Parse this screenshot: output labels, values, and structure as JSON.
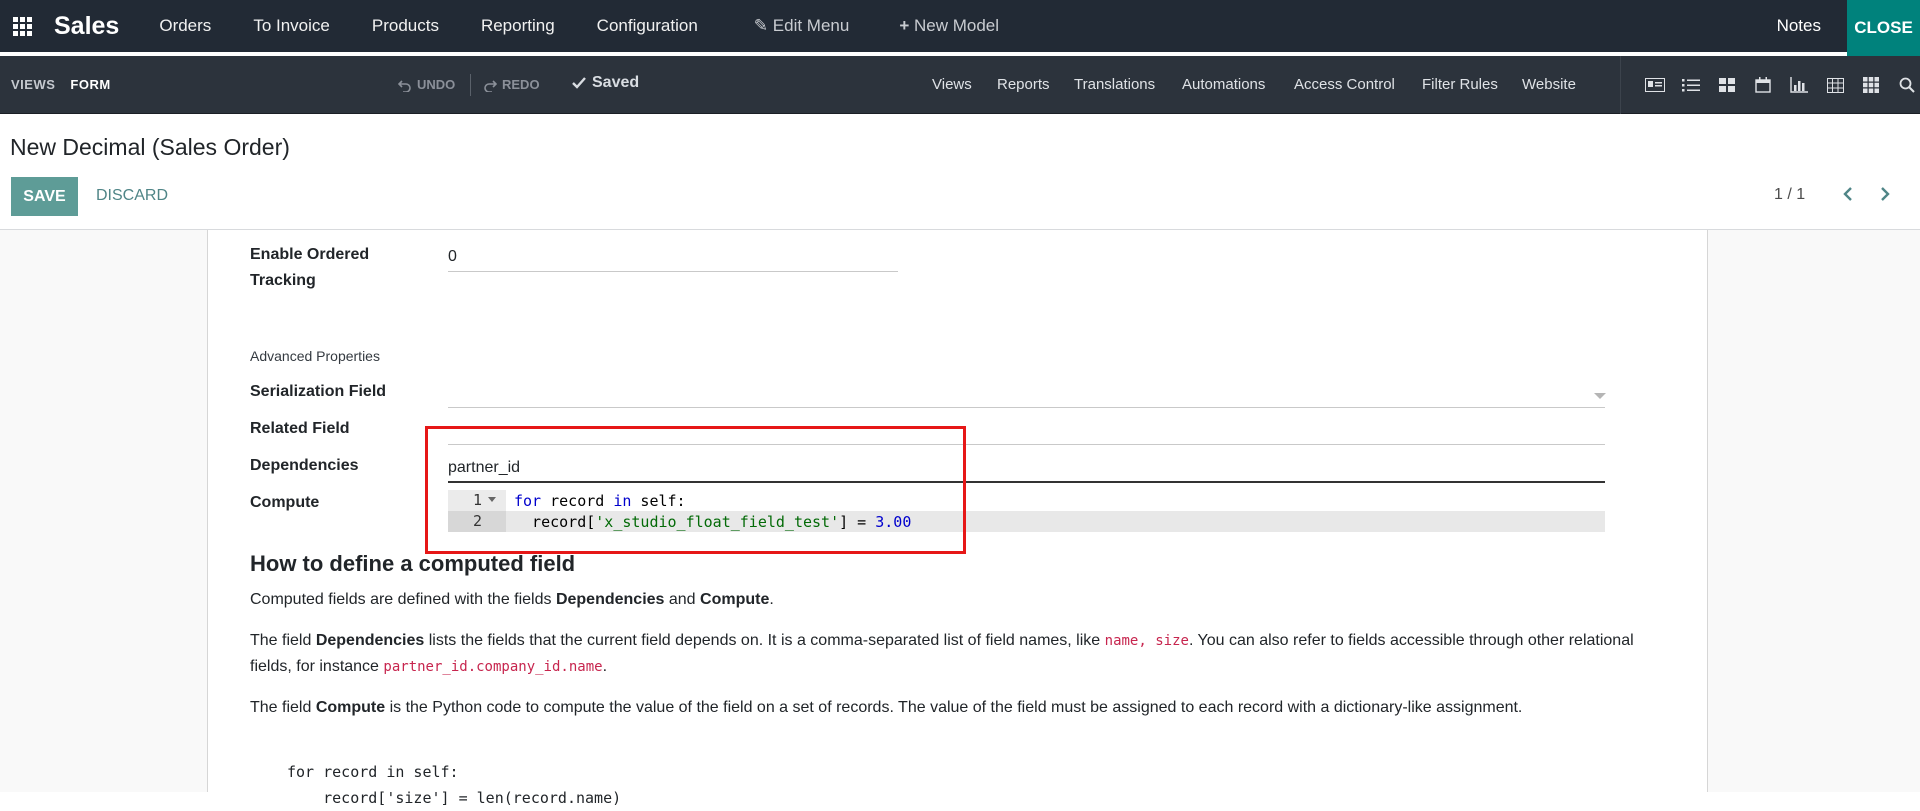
{
  "topbar": {
    "app_name": "Sales",
    "menu": [
      "Orders",
      "To Invoice",
      "Products",
      "Reporting",
      "Configuration"
    ],
    "edit_menu": "Edit Menu",
    "new_model": "New Model",
    "notes": "Notes",
    "close": "CLOSE"
  },
  "studiobar": {
    "views": "VIEWS",
    "form": "FORM",
    "undo": "UNDO",
    "redo": "REDO",
    "saved": "Saved",
    "menu": [
      "Views",
      "Reports",
      "Translations",
      "Automations",
      "Access Control",
      "Filter Rules",
      "Website"
    ]
  },
  "control_panel": {
    "title": "New Decimal (Sales Order)",
    "save": "SAVE",
    "discard": "DISCARD",
    "pager": "1 / 1"
  },
  "form": {
    "enable_ordered_tracking_label_1": "Enable Ordered",
    "enable_ordered_tracking_label_2": "Tracking",
    "enable_ordered_tracking_value": "0",
    "advanced_properties": "Advanced Properties",
    "serialization_field_label": "Serialization Field",
    "related_field_label": "Related Field",
    "dependencies_label": "Dependencies",
    "dependencies_value": "partner_id",
    "compute_label": "Compute",
    "code": {
      "line1_no": "1",
      "line2_no": "2",
      "line1_kw1": "for",
      "line1_t1": " record ",
      "line1_kw2": "in",
      "line1_t2": " self:",
      "line2_t1": "  record[",
      "line2_str": "'x_studio_float_field_test'",
      "line2_t2": "] = ",
      "line2_num": "3.00"
    }
  },
  "help": {
    "heading": "How to define a computed field",
    "p1_a": "Computed fields are defined with the fields ",
    "p1_b": "Dependencies",
    "p1_c": " and ",
    "p1_d": "Compute",
    "p1_e": ".",
    "p2_a": "The field ",
    "p2_b": "Dependencies",
    "p2_c": " lists the fields that the current field depends on. It is a comma-separated list of field names, like ",
    "p2_code1": "name, size",
    "p2_d": ". You can also refer to fields accessible through other relational fields, for instance ",
    "p2_code2": "partner_id.company_id.name",
    "p2_e": ".",
    "p3_a": "The field ",
    "p3_b": "Compute",
    "p3_c": " is the Python code to compute the value of the field on a set of records. The value of the field must be assigned to each record with a dictionary-like assignment.",
    "pre": "for record in self:\n    record['size'] = len(record.name)"
  },
  "colors": {
    "topbar_bg": "#222a35",
    "close_bg": "#00827c",
    "save_bg": "#5e9c97",
    "highlight_box": "#e61717"
  }
}
